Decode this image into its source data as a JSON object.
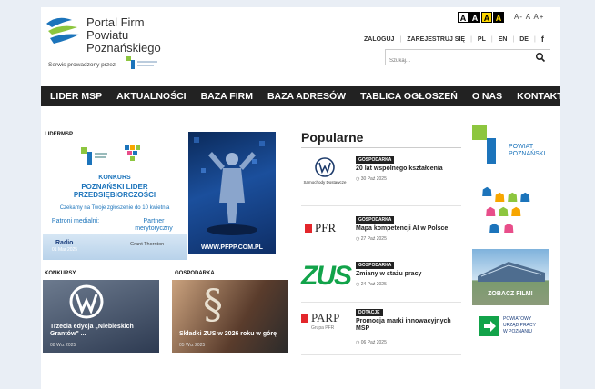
{
  "header": {
    "logo_line1": "Portal Firm",
    "logo_line2": "Powiatu Poznańskiego",
    "serwis_text": "Serwis prowadzony przez",
    "contrast": [
      "A",
      "A",
      "A",
      "A"
    ],
    "font_sizes": "A- A A+",
    "top_links": [
      "ZALOGUJ",
      "ZAREJESTRUJ SIĘ",
      "PL",
      "EN",
      "DE"
    ],
    "facebook": "f",
    "search_placeholder": "Szukaj..."
  },
  "nav": [
    "LIDER MSP",
    "AKTUALNOŚCI",
    "BAZA FIRM",
    "BAZA ADRESÓW",
    "TABLICA OGŁOSZEŃ",
    "O NAS",
    "KONTAKT"
  ],
  "lidermsp": {
    "label": "LIDERMSP",
    "konkurs": "KONKURS",
    "title_line1": "POZNAŃSKI LIDER",
    "title_line2": "PRZEDSIĘBIORCZOŚCI",
    "czekamy": "Czekamy na Twoje zgłoszenie do 10 kwietnia",
    "patroni": "Patroni medialni:",
    "partner": "Partner merytoryczny",
    "radio": "Radio",
    "grant": "Grant Thornton",
    "date": "01 Mar 2025",
    "url": "WWW.PFPP.COM.PL"
  },
  "tiles": [
    {
      "label": "KONKURSY",
      "caption": "Trzecia edycja „Niebieskich Grantów\" ...",
      "date": "08 Wrz 2025"
    },
    {
      "label": "GOSPODARKA",
      "caption": "Składki ZUS w 2026 roku w górę",
      "date": "05 Wrz 2025"
    }
  ],
  "popular": {
    "title": "Popularne",
    "items": [
      {
        "category": "GOSPODARKA",
        "title": "20 lat wspólnego kształcenia",
        "date": "30 Paź 2025",
        "logo": "Samochody Dostawcze"
      },
      {
        "category": "GOSPODARKA",
        "title": "Mapa kompetencji AI w Polsce",
        "date": "27 Paź 2025",
        "logo": "PFR"
      },
      {
        "category": "GOSPODARKA",
        "title": "Zmiany w stażu pracy",
        "date": "24 Paź 2025",
        "logo": "ZUS"
      },
      {
        "category": "DOTACJE",
        "title": "Promocja marki innowacyjnych MŚP",
        "date": "06 Paź 2025",
        "logo": "PARP"
      }
    ],
    "parp_sub": "Grupa PFR"
  },
  "side": {
    "powiat_line1": "POWIAT",
    "powiat_line2": "POZNAŃSKI",
    "film_caption": "ZOBACZ FILM!",
    "pup_line1": "POWIATOWY",
    "pup_line2": "URZĄD PRACY",
    "pup_line3": "W POZNANIU"
  }
}
